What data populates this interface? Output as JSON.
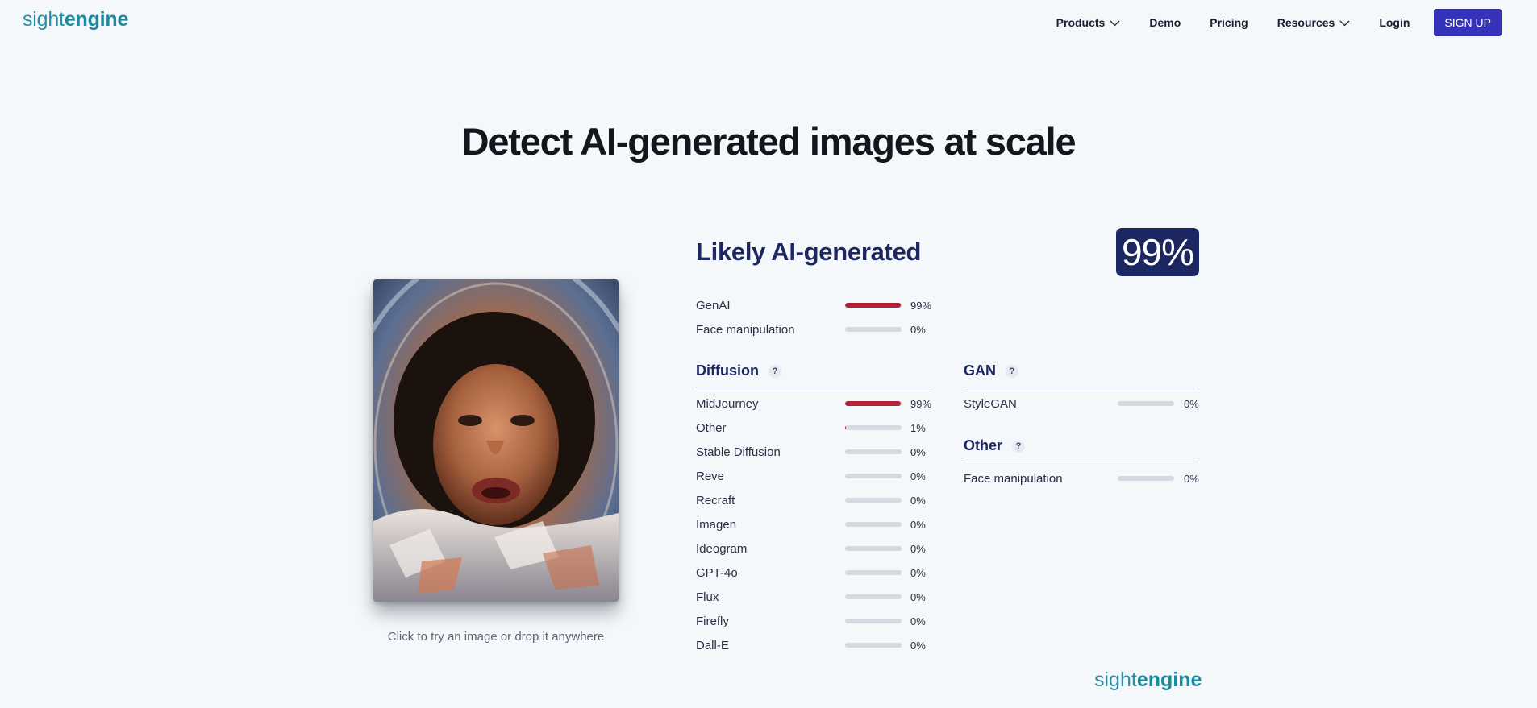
{
  "brand": {
    "logo_part1": "sight",
    "logo_part2": "engine"
  },
  "nav": {
    "products": "Products",
    "demo": "Demo",
    "pricing": "Pricing",
    "resources": "Resources",
    "login": "Login",
    "signup": "SIGN UP"
  },
  "hero": {
    "title": "Detect AI-generated images at scale"
  },
  "upload": {
    "caption": "Click to try an image or drop it anywhere"
  },
  "result": {
    "verdict": "Likely AI-generated",
    "score": "99%"
  },
  "top_scores": [
    {
      "label": "GenAI",
      "value": 0.99,
      "pct": "99%"
    },
    {
      "label": "Face manipulation",
      "value": 0.0,
      "pct": "0%"
    }
  ],
  "diffusion": {
    "title": "Diffusion",
    "help": "?",
    "items": [
      {
        "label": "MidJourney",
        "value": 0.99,
        "pct": "99%"
      },
      {
        "label": "Other",
        "value": 0.01,
        "pct": "1%"
      },
      {
        "label": "Stable Diffusion",
        "value": 0.0,
        "pct": "0%"
      },
      {
        "label": "Reve",
        "value": 0.0,
        "pct": "0%"
      },
      {
        "label": "Recraft",
        "value": 0.0,
        "pct": "0%"
      },
      {
        "label": "Imagen",
        "value": 0.0,
        "pct": "0%"
      },
      {
        "label": "Ideogram",
        "value": 0.0,
        "pct": "0%"
      },
      {
        "label": "GPT-4o",
        "value": 0.0,
        "pct": "0%"
      },
      {
        "label": "Flux",
        "value": 0.0,
        "pct": "0%"
      },
      {
        "label": "Firefly",
        "value": 0.0,
        "pct": "0%"
      },
      {
        "label": "Dall-E",
        "value": 0.0,
        "pct": "0%"
      }
    ]
  },
  "gan": {
    "title": "GAN",
    "help": "?",
    "items": [
      {
        "label": "StyleGAN",
        "value": 0.0,
        "pct": "0%"
      }
    ]
  },
  "other": {
    "title": "Other",
    "help": "?",
    "items": [
      {
        "label": "Face manipulation",
        "value": 0.0,
        "pct": "0%"
      }
    ]
  },
  "colors": {
    "accent": "#1c2660",
    "signup": "#3533b9",
    "bar_fill": "#b3213a",
    "bar_track": "#d4d9e2",
    "brand": "#1a8a9e"
  }
}
